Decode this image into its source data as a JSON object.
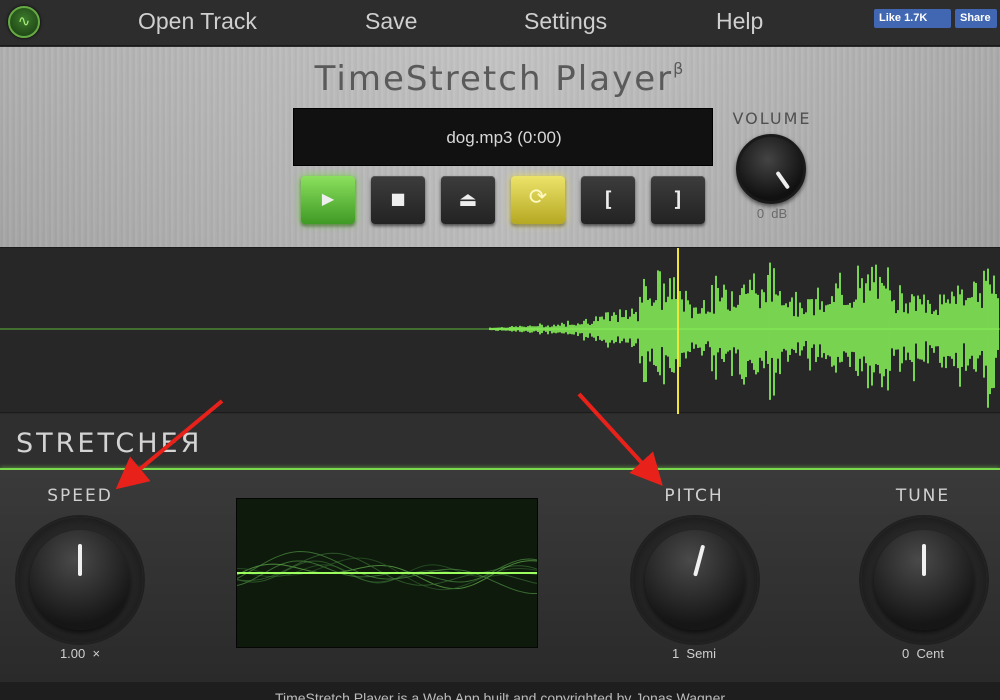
{
  "nav": {
    "items": [
      {
        "label": "Open Track"
      },
      {
        "label": "Save"
      },
      {
        "label": "Settings"
      },
      {
        "label": "Help"
      }
    ],
    "facebook_like_label": "Like 1.7K",
    "facebook_share_label": "Share"
  },
  "player": {
    "title": "TimeStretch Player",
    "title_superscript": "β",
    "display_text": "dog.mp3 (0:00)",
    "buttons": [
      {
        "icon": "play-icon",
        "glyph": "▶"
      },
      {
        "icon": "stop-icon",
        "glyph": "■"
      },
      {
        "icon": "eject-icon",
        "glyph": "⏏"
      },
      {
        "icon": "loop-icon",
        "glyph": "⟳"
      },
      {
        "icon": "loop-start-icon",
        "glyph": "["
      },
      {
        "icon": "loop-end-icon",
        "glyph": "]"
      }
    ],
    "volume": {
      "label": "VOLUME",
      "value_text": "0  dB"
    }
  },
  "waveform": {
    "playhead_position_fraction": 0.678,
    "color": "#8dff5c"
  },
  "stretcher": {
    "title": "STRETCHEЯ",
    "speed": {
      "label": "SPEED",
      "value_text": "1.00  ×"
    },
    "pitch": {
      "label": "PITCH",
      "value_text": "1  Semi"
    },
    "tune": {
      "label": "TUNE",
      "value_text": "0  Cent"
    }
  },
  "footer": {
    "text": "TimeStretch Player is a Web App built and copyrighted by Jonas Wagner"
  },
  "colors": {
    "accent_green": "#7ad94d",
    "loop_yellow": "#e7dc5a",
    "annotation_red": "#e8221a"
  }
}
